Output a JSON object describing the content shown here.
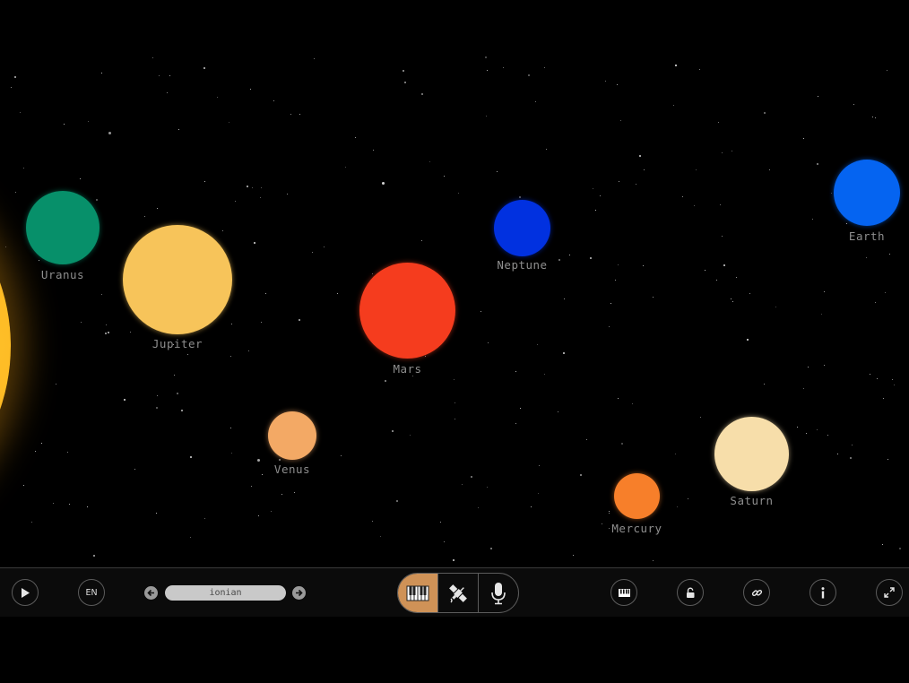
{
  "planets": [
    {
      "name": "Uranus",
      "color": "#07906a"
    },
    {
      "name": "Jupiter",
      "color": "#f7c45a"
    },
    {
      "name": "Mars",
      "color": "#f53c1e"
    },
    {
      "name": "Neptune",
      "color": "#0131e0"
    },
    {
      "name": "Earth",
      "color": "#0564f1"
    },
    {
      "name": "Venus",
      "color": "#f3a965"
    },
    {
      "name": "Saturn",
      "color": "#f7deaa"
    },
    {
      "name": "Mercury",
      "color": "#f77f2a"
    }
  ],
  "sun_color": "#ffc02a",
  "toolbar": {
    "play_icon": "play-icon",
    "language": "EN",
    "scale": "ionian",
    "prev_scale_icon": "arrow-left-icon",
    "next_scale_icon": "arrow-right-icon",
    "modes": [
      {
        "icon": "piano-keys-icon",
        "active": true
      },
      {
        "icon": "satellite-icon",
        "active": false
      },
      {
        "icon": "microphone-icon",
        "active": false
      }
    ],
    "midi_icon": "piano-keys-icon",
    "lock_icon": "unlock-icon",
    "link_icon": "link-icon",
    "info_icon": "info-icon",
    "fullscreen_icon": "expand-icon",
    "active_color": "#cf9257"
  }
}
